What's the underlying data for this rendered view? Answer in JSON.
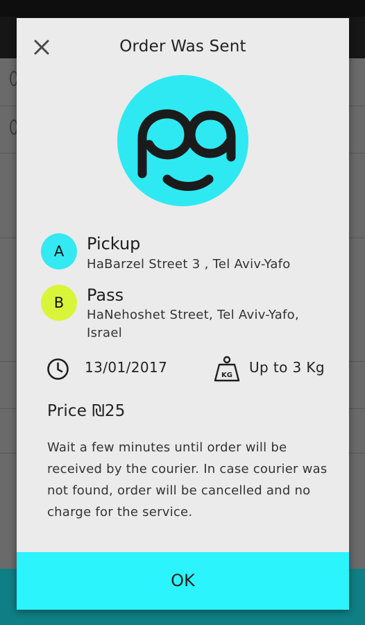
{
  "dialog": {
    "title": "Order Was Sent",
    "close_icon": "close-icon",
    "logo_icon": "pass-logo-icon"
  },
  "pickup": {
    "marker": "A",
    "label": "Pickup",
    "address": "HaBarzel Street 3 , Tel Aviv-Yafo"
  },
  "dropoff": {
    "marker": "B",
    "label": "Pass",
    "address": "HaNehoshet Street, Tel Aviv-Yafo, Israel"
  },
  "details": {
    "date_icon": "clock-icon",
    "date": "13/01/2017",
    "weight_icon": "weight-kg-icon",
    "weight": "Up to 3 Kg"
  },
  "price": "Price ₪25",
  "description": "Wait a few minutes until order will be received by the courier. In case courier was not found, order will be cancelled and no charge for the service.",
  "ok_label": "OK",
  "colors": {
    "accent_cyan": "#2ee9f2",
    "marker_a": "#34e9f1",
    "marker_b": "#d9f53a",
    "ok_button": "#2cf4fc",
    "dialog_bg": "#ebebeb"
  }
}
